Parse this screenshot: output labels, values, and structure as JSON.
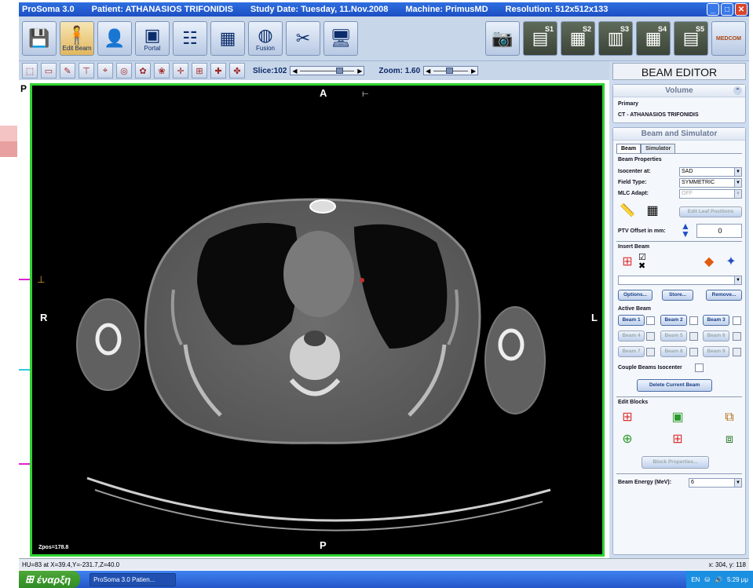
{
  "window": {
    "app": "ProSoma 3.0",
    "patient": "Patient:  ATHANASIOS TRIFONIDIS",
    "study_date": "Study Date:  Tuesday, 11.Nov.2008",
    "machine": "Machine:  PrimusMD",
    "resolution": "Resolution:  512x512x133"
  },
  "toolbar": {
    "edit_beam_label": "Edit Beam",
    "portal_label": "Portal",
    "fusion_label": "Fusion",
    "view_badges": [
      "S1",
      "S2",
      "S3",
      "S4",
      "S5"
    ],
    "medcom_logo": "MEDCOM"
  },
  "viewer_controls": {
    "slice_label": "Slice:102",
    "zoom_label": "Zoom: 1.60",
    "slice_position": 0.76,
    "zoom_position": 0.45
  },
  "viewport": {
    "orient_top": "A",
    "orient_bottom": "P",
    "orient_left": "R",
    "orient_right": "L",
    "corner_label": "P",
    "zpos": "Zpos=178.8"
  },
  "status": {
    "left": "HU=83 at X=39.4,Y=-231.7,Z=40.0",
    "right": "x: 304, y: 118"
  },
  "taskbar": {
    "start": "έναρξη",
    "task": "ProSoma 3.0   Patien...",
    "tray_lang": "EN",
    "clock": "5:29 μμ"
  },
  "beam_editor": {
    "title": "BEAM EDITOR",
    "volume_header": "Volume",
    "volume_primary": "Primary",
    "volume_name": "CT - ATHANASIOS TRIFONIDIS",
    "beam_sim_header": "Beam and Simulator",
    "tabs": [
      "Beam",
      "Simulator"
    ],
    "beam_properties_label": "Beam Properties",
    "isocenter_label": "Isocenter at:",
    "isocenter_value": "SAD",
    "field_type_label": "Field Type:",
    "field_type_value": "SYMMETRIC",
    "mlc_adapt_label": "MLC Adapt:",
    "mlc_adapt_value": "OFF",
    "edit_leaf_button": "Edit Leaf Positions",
    "ptv_offset_label": "PTV Offset in mm:",
    "ptv_offset_value": "0",
    "insert_beam_label": "Insert Beam",
    "options_button": "Options...",
    "store_button": "Store...",
    "remove_button": "Remove...",
    "active_beam_label": "Active Beam",
    "beams": [
      "Beam 1",
      "Beam 2",
      "Beam 3",
      "Beam 4",
      "Beam 5",
      "Beam 6",
      "Beam 7",
      "Beam 8",
      "Beam 9"
    ],
    "couple_label": "Couple Beams Isocenter",
    "delete_button": "Delete Current Beam",
    "edit_blocks_label": "Edit Blocks",
    "block_properties_button": "Block Properties...",
    "beam_energy_label": "Beam Energy (MeV):",
    "beam_energy_value": "6"
  },
  "colors": {
    "viewport_border": "#2fd42f",
    "titlebar": "#1c4fc4",
    "panel_bg": "#cfdcef"
  }
}
